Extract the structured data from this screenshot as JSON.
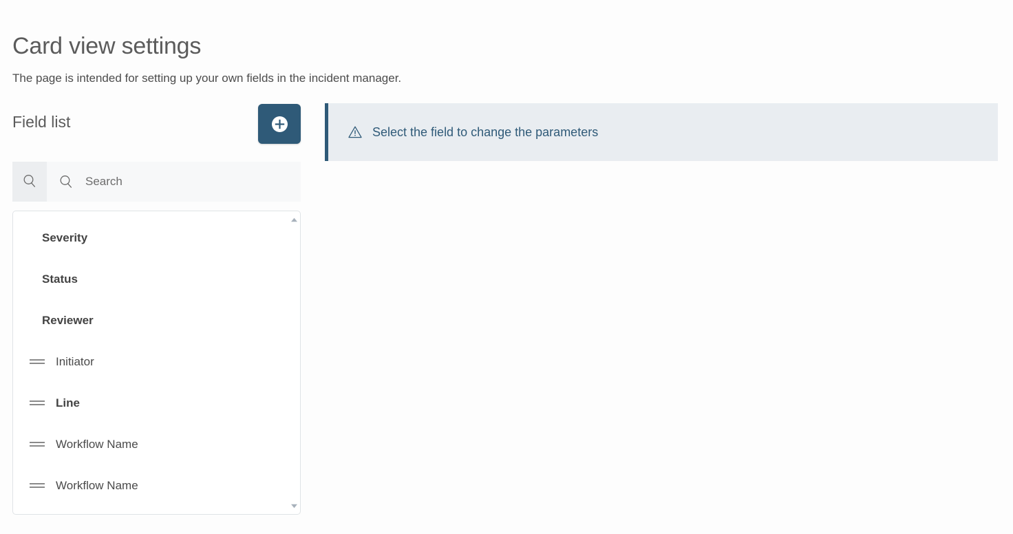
{
  "header": {
    "title": "Card view settings",
    "subtitle": "The page is intended for setting up your own fields in the incident manager."
  },
  "field_list": {
    "title": "Field list",
    "add_button_label": "",
    "add_button_icon": "plus-circle-icon",
    "add_button_color": "#2f5a78"
  },
  "search": {
    "placeholder": "Search",
    "value": "",
    "button_icon": "search-icon",
    "input_icon": "search-icon"
  },
  "list": {
    "items": [
      {
        "label": "Severity",
        "bold": true,
        "draggable": false
      },
      {
        "label": "Status",
        "bold": true,
        "draggable": false
      },
      {
        "label": "Reviewer",
        "bold": true,
        "draggable": false
      },
      {
        "label": "Initiator",
        "bold": false,
        "draggable": true
      },
      {
        "label": "Line",
        "bold": true,
        "draggable": true
      },
      {
        "label": "Workflow Name",
        "bold": false,
        "draggable": true
      },
      {
        "label": "Workflow Name",
        "bold": false,
        "draggable": true
      }
    ],
    "scrollbar": {
      "up_icon": "triangle-up-icon",
      "down_icon": "triangle-down-icon"
    }
  },
  "alert": {
    "icon": "warning-triangle-icon",
    "message": "Select the field to change the parameters",
    "accent_color": "#2f5a78",
    "background_color": "#e9edf1"
  }
}
